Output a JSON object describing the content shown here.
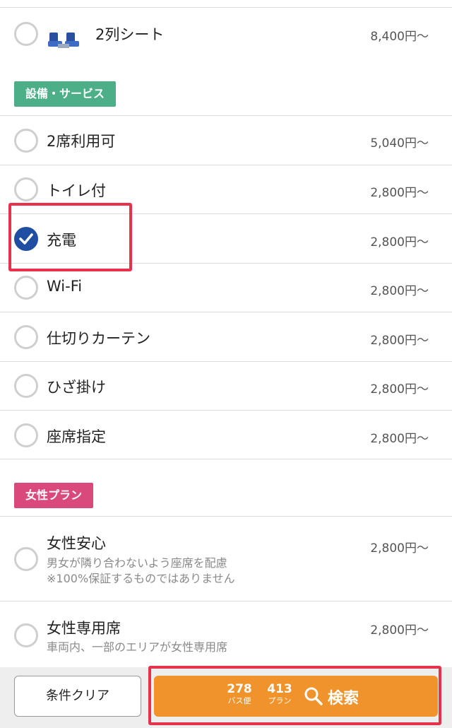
{
  "seat_row": {
    "label": "2列シート",
    "price": "8,400円〜",
    "icon": "double-seat-icon"
  },
  "sections": {
    "equipment": {
      "title": "設備・サービス",
      "color": "#4caf87"
    },
    "women": {
      "title": "女性プラン",
      "color": "#d9497c"
    }
  },
  "equipment_items": [
    {
      "label": "2席利用可",
      "price": "5,040円〜",
      "checked": false
    },
    {
      "label": "トイレ付",
      "price": "2,800円〜",
      "checked": false
    },
    {
      "label": "充電",
      "price": "2,800円〜",
      "checked": true
    },
    {
      "label": "Wi-Fi",
      "price": "2,800円〜",
      "checked": false
    },
    {
      "label": "仕切りカーテン",
      "price": "2,800円〜",
      "checked": false
    },
    {
      "label": "ひざ掛け",
      "price": "2,800円〜",
      "checked": false
    },
    {
      "label": "座席指定",
      "price": "2,800円〜",
      "checked": false
    }
  ],
  "women_items": [
    {
      "label": "女性安心",
      "price": "2,800円〜",
      "desc1": "男女が隣り合わないよう座席を配慮",
      "desc2": "※100%保証するものではありません"
    },
    {
      "label": "女性専用席",
      "price": "2,800円〜",
      "desc1": "車両内、一部のエリアが女性専用席"
    }
  ],
  "footer": {
    "clear_label": "条件クリア",
    "bus_count": "278",
    "bus_unit": "バス便",
    "plan_count": "413",
    "plan_unit": "プラン",
    "search_label": "検索"
  },
  "colors": {
    "accent": "#f0932b",
    "check": "#1f4ea3",
    "highlight": "#e8314b"
  }
}
